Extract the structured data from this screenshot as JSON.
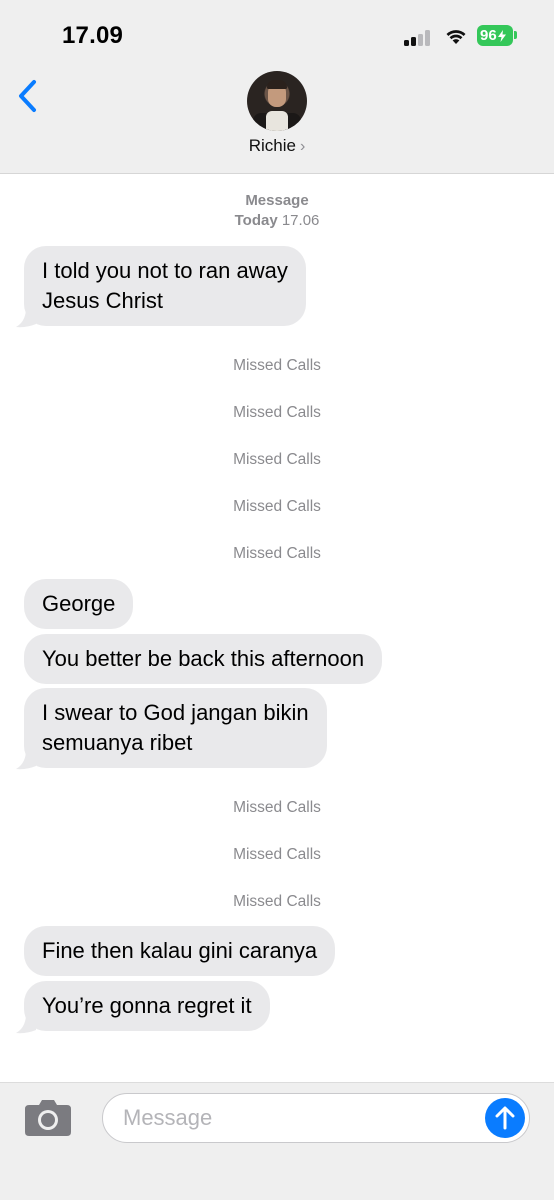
{
  "status_bar": {
    "time": "17.09",
    "battery": "96"
  },
  "header": {
    "contact_name": "Richie",
    "chevron": "›"
  },
  "thread": {
    "service_label": "Message",
    "date_label": "Today",
    "time_label": "17.06",
    "items": [
      {
        "type": "bubble",
        "lines": [
          "I told you not to ran away",
          "Jesus Christ"
        ]
      },
      {
        "type": "missed",
        "text": "Missed Calls"
      },
      {
        "type": "missed",
        "text": "Missed Calls"
      },
      {
        "type": "missed",
        "text": "Missed Calls"
      },
      {
        "type": "missed",
        "text": "Missed Calls"
      },
      {
        "type": "missed",
        "text": "Missed Calls"
      },
      {
        "type": "bubble",
        "lines": [
          "George"
        ]
      },
      {
        "type": "bubble",
        "lines": [
          "You better be back this afternoon"
        ]
      },
      {
        "type": "bubble",
        "lines": [
          "I swear to God jangan bikin",
          "semuanya ribet"
        ]
      },
      {
        "type": "missed",
        "text": "Missed Calls"
      },
      {
        "type": "missed",
        "text": "Missed Calls"
      },
      {
        "type": "missed",
        "text": "Missed Calls"
      },
      {
        "type": "bubble",
        "lines": [
          "Fine then kalau gini caranya"
        ]
      },
      {
        "type": "bubble",
        "lines": [
          "You’re gonna regret it"
        ]
      }
    ]
  },
  "composer": {
    "placeholder": "Message",
    "value": ""
  },
  "colors": {
    "accent": "#0a7cff",
    "bubble": "#e9e9eb",
    "battery": "#34c759",
    "meta_text": "#8a8a8e"
  },
  "icons": {
    "back": "chevron-left-icon",
    "camera": "camera-icon",
    "send": "arrow-up-icon",
    "signal": "cellular-signal-icon",
    "wifi": "wifi-icon",
    "battery": "battery-icon"
  }
}
